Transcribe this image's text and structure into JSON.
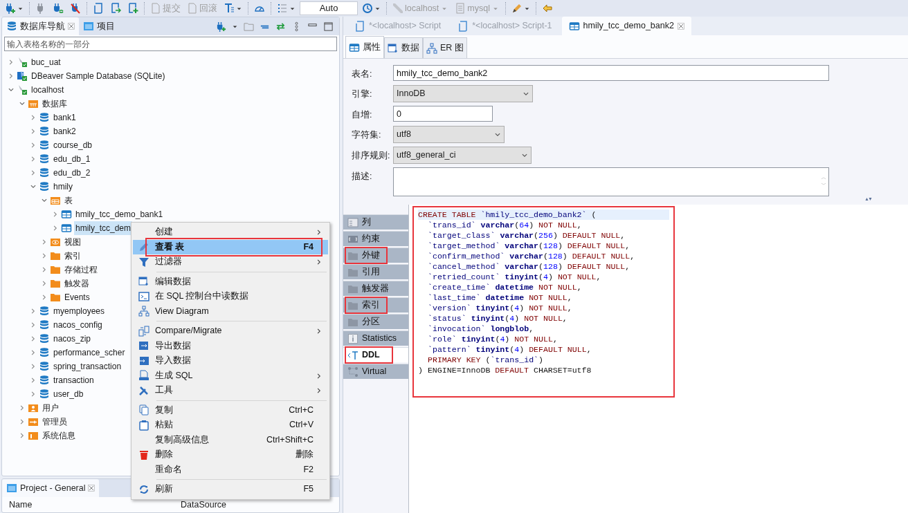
{
  "toolbar": [
    {
      "kind": "icon",
      "dropdown": true
    },
    {
      "kind": "separator"
    },
    {
      "kind": "icon",
      "dropdown": false
    },
    {
      "kind": "icon",
      "dropdown": false
    },
    {
      "kind": "icon",
      "dropdown": false
    },
    {
      "kind": "separator"
    },
    {
      "kind": "icon",
      "dropdown": false
    },
    {
      "kind": "icon",
      "dropdown": false
    },
    {
      "kind": "icon",
      "dropdown": false
    },
    {
      "kind": "separator"
    },
    {
      "kind": "button",
      "label": "提交",
      "disabled": true
    },
    {
      "kind": "button",
      "label": "回滚",
      "disabled": true
    },
    {
      "kind": "icon",
      "dropdown": true
    },
    {
      "kind": "separator"
    },
    {
      "kind": "icon",
      "dropdown": false
    },
    {
      "kind": "separator"
    },
    {
      "kind": "icon",
      "dropdown": true
    },
    {
      "kind": "field",
      "value": "Auto"
    },
    {
      "kind": "icon",
      "dropdown": true
    },
    {
      "kind": "separator"
    },
    {
      "kind": "combo",
      "label": "localhost",
      "disabled": true
    },
    {
      "kind": "combo",
      "label": "mysql",
      "disabled": true
    },
    {
      "kind": "separator"
    },
    {
      "kind": "icon",
      "dropdown": true
    },
    {
      "kind": "separator"
    },
    {
      "kind": "icon",
      "dropdown": false
    }
  ],
  "navigator": {
    "tabs": [
      {
        "label": "数据库导航",
        "selected": true,
        "closable": true
      },
      {
        "label": "项目",
        "selected": false,
        "closable": false
      }
    ],
    "search": {
      "placeholder": "输入表格名称的一部分"
    },
    "tree": [
      {
        "label": "buc_uat",
        "kind": "connection",
        "expanded": false,
        "selected": false
      },
      {
        "label": "DBeaver Sample Database (SQLite)",
        "kind": "sqlite",
        "expanded": false,
        "selected": false
      },
      {
        "label": "localhost",
        "kind": "connection",
        "expanded": true,
        "selected": false,
        "children": [
          {
            "label": "数据库",
            "kind": "databases",
            "expanded": true,
            "selected": false,
            "children": [
              {
                "label": "bank1",
                "kind": "db",
                "expanded": false,
                "selected": false
              },
              {
                "label": "bank2",
                "kind": "db",
                "expanded": false,
                "selected": false
              },
              {
                "label": "course_db",
                "kind": "db",
                "expanded": false,
                "selected": false
              },
              {
                "label": "edu_db_1",
                "kind": "db",
                "expanded": false,
                "selected": false
              },
              {
                "label": "edu_db_2",
                "kind": "db",
                "expanded": false,
                "selected": false
              },
              {
                "label": "hmily",
                "kind": "db",
                "expanded": true,
                "selected": false,
                "children": [
                  {
                    "label": "表",
                    "kind": "tables",
                    "expanded": true,
                    "selected": false,
                    "children": [
                      {
                        "label": "hmily_tcc_demo_bank1",
                        "kind": "table",
                        "expanded": false,
                        "selected": false
                      },
                      {
                        "label": "hmily_tcc_dem",
                        "kind": "table",
                        "expanded": false,
                        "selected": true
                      }
                    ]
                  },
                  {
                    "label": "视图",
                    "kind": "views",
                    "expanded": false,
                    "selected": false
                  },
                  {
                    "label": "索引",
                    "kind": "folder",
                    "expanded": false,
                    "selected": false
                  },
                  {
                    "label": "存储过程",
                    "kind": "folder",
                    "expanded": false,
                    "selected": false
                  },
                  {
                    "label": "触发器",
                    "kind": "folder",
                    "expanded": false,
                    "selected": false
                  },
                  {
                    "label": "Events",
                    "kind": "folder",
                    "expanded": false,
                    "selected": false
                  }
                ]
              },
              {
                "label": "myemployees",
                "kind": "db",
                "expanded": false,
                "selected": false
              },
              {
                "label": "nacos_config",
                "kind": "db",
                "expanded": false,
                "selected": false
              },
              {
                "label": "nacos_zip",
                "kind": "db",
                "expanded": false,
                "selected": false
              },
              {
                "label": "performance_scher",
                "kind": "db",
                "expanded": false,
                "selected": false
              },
              {
                "label": "spring_transaction",
                "kind": "db",
                "expanded": false,
                "selected": false
              },
              {
                "label": "transaction",
                "kind": "db",
                "expanded": false,
                "selected": false
              },
              {
                "label": "user_db",
                "kind": "db",
                "expanded": false,
                "selected": false
              }
            ]
          },
          {
            "label": "用户",
            "kind": "users",
            "expanded": false,
            "selected": false
          },
          {
            "label": "管理员",
            "kind": "admin",
            "expanded": false,
            "selected": false
          },
          {
            "label": "系统信息",
            "kind": "info",
            "expanded": false,
            "selected": false
          }
        ]
      }
    ]
  },
  "project_panel": {
    "tab": "Project - General",
    "columns": [
      "Name",
      "DataSource"
    ]
  },
  "context_menu": [
    {
      "kind": "item",
      "label": "创建",
      "submenu": true,
      "selected": false,
      "annotated": false
    },
    {
      "kind": "item",
      "label": "查看 表",
      "shortcut": "F4",
      "submenu": false,
      "selected": true,
      "annotated": true
    },
    {
      "kind": "item",
      "label": "过滤器",
      "submenu": true,
      "selected": false,
      "annotated": false
    },
    {
      "kind": "separator"
    },
    {
      "kind": "item",
      "label": "编辑数据",
      "submenu": false,
      "selected": false,
      "annotated": false
    },
    {
      "kind": "item",
      "label": "在 SQL 控制台中读数据",
      "submenu": false,
      "selected": false,
      "annotated": false
    },
    {
      "kind": "item",
      "label": "View Diagram",
      "submenu": false,
      "selected": false,
      "annotated": false
    },
    {
      "kind": "separator"
    },
    {
      "kind": "item",
      "label": "Compare/Migrate",
      "submenu": true,
      "selected": false,
      "annotated": false
    },
    {
      "kind": "item",
      "label": "导出数据",
      "submenu": false,
      "selected": false,
      "annotated": false
    },
    {
      "kind": "item",
      "label": "导入数据",
      "submenu": false,
      "selected": false,
      "annotated": false
    },
    {
      "kind": "item",
      "label": "生成 SQL",
      "submenu": true,
      "selected": false,
      "annotated": false
    },
    {
      "kind": "item",
      "label": "工具",
      "submenu": true,
      "selected": false,
      "annotated": false
    },
    {
      "kind": "separator"
    },
    {
      "kind": "item",
      "label": "复制",
      "shortcut": "Ctrl+C",
      "submenu": false,
      "selected": false,
      "annotated": false
    },
    {
      "kind": "item",
      "label": "粘贴",
      "shortcut": "Ctrl+V",
      "submenu": false,
      "selected": false,
      "annotated": false
    },
    {
      "kind": "item",
      "label": "复制高级信息",
      "shortcut": "Ctrl+Shift+C",
      "submenu": false,
      "selected": false,
      "annotated": false
    },
    {
      "kind": "item",
      "label": "删除",
      "shortcut": "删除",
      "submenu": false,
      "selected": false,
      "annotated": false
    },
    {
      "kind": "item",
      "label": "重命名",
      "shortcut": "F2",
      "submenu": false,
      "selected": false,
      "annotated": false
    },
    {
      "kind": "separator"
    },
    {
      "kind": "item",
      "label": "刷新",
      "shortcut": "F5",
      "submenu": false,
      "selected": false,
      "annotated": false
    }
  ],
  "editor": {
    "tabs": [
      {
        "label": "*<localhost> Script",
        "selected": false,
        "closable": false
      },
      {
        "label": "*<localhost> Script-1",
        "selected": false,
        "closable": false
      },
      {
        "label": "hmily_tcc_demo_bank2",
        "selected": true,
        "closable": true
      }
    ],
    "subtabs": [
      {
        "label": "属性",
        "selected": true
      },
      {
        "label": "数据",
        "selected": false
      },
      {
        "label": "ER 图",
        "selected": false
      }
    ],
    "fields": [
      {
        "label": "表名:",
        "kind": "text",
        "value": "hmily_tcc_demo_bank2"
      },
      {
        "label": "引擎:",
        "kind": "select",
        "value": "InnoDB"
      },
      {
        "label": "自增:",
        "kind": "text",
        "value": "0"
      },
      {
        "label": "字符集:",
        "kind": "select",
        "value": "utf8"
      },
      {
        "label": "排序规则:",
        "kind": "select",
        "value": "utf8_general_ci"
      },
      {
        "label": "描述:",
        "kind": "textarea"
      }
    ],
    "side_tabs": [
      {
        "label": "列",
        "selected": false,
        "annotated": false
      },
      {
        "label": "约束",
        "selected": false,
        "annotated": false
      },
      {
        "label": "外键",
        "selected": false,
        "annotated": true
      },
      {
        "label": "引用",
        "selected": false,
        "annotated": false
      },
      {
        "label": "触发器",
        "selected": false,
        "annotated": false
      },
      {
        "label": "索引",
        "selected": false,
        "annotated": true
      },
      {
        "label": "分区",
        "selected": false,
        "annotated": false
      },
      {
        "label": "Statistics",
        "selected": false,
        "annotated": false
      },
      {
        "label": "DDL",
        "selected": true,
        "annotated": true
      },
      {
        "label": "Virtual",
        "selected": false,
        "annotated": false
      }
    ],
    "ddl": {
      "annotated": true,
      "lines": [
        {
          "indent": false,
          "tokens": [
            {
              "kind": "kw",
              "text": "CREATE TABLE "
            },
            {
              "kind": "ident",
              "text": "`hmily_tcc_demo_bank2` "
            },
            {
              "kind": "plain",
              "text": "("
            }
          ]
        },
        {
          "indent": true,
          "tokens": [
            {
              "kind": "ident",
              "text": "`trans_id` "
            },
            {
              "kind": "type",
              "text": "varchar"
            },
            {
              "kind": "plain",
              "text": "("
            },
            {
              "kind": "num",
              "text": "64"
            },
            {
              "kind": "plain",
              "text": ") "
            },
            {
              "kind": "kw",
              "text": "NOT NULL"
            },
            {
              "kind": "plain",
              "text": ","
            }
          ]
        },
        {
          "indent": true,
          "tokens": [
            {
              "kind": "ident",
              "text": "`target_class` "
            },
            {
              "kind": "type",
              "text": "varchar"
            },
            {
              "kind": "plain",
              "text": "("
            },
            {
              "kind": "num",
              "text": "256"
            },
            {
              "kind": "plain",
              "text": ") "
            },
            {
              "kind": "kw",
              "text": "DEFAULT NULL"
            },
            {
              "kind": "plain",
              "text": ","
            }
          ]
        },
        {
          "indent": true,
          "tokens": [
            {
              "kind": "ident",
              "text": "`target_method` "
            },
            {
              "kind": "type",
              "text": "varchar"
            },
            {
              "kind": "plain",
              "text": "("
            },
            {
              "kind": "num",
              "text": "128"
            },
            {
              "kind": "plain",
              "text": ") "
            },
            {
              "kind": "kw",
              "text": "DEFAULT NULL"
            },
            {
              "kind": "plain",
              "text": ","
            }
          ]
        },
        {
          "indent": true,
          "tokens": [
            {
              "kind": "ident",
              "text": "`confirm_method` "
            },
            {
              "kind": "type",
              "text": "varchar"
            },
            {
              "kind": "plain",
              "text": "("
            },
            {
              "kind": "num",
              "text": "128"
            },
            {
              "kind": "plain",
              "text": ") "
            },
            {
              "kind": "kw",
              "text": "DEFAULT NULL"
            },
            {
              "kind": "plain",
              "text": ","
            }
          ]
        },
        {
          "indent": true,
          "tokens": [
            {
              "kind": "ident",
              "text": "`cancel_method` "
            },
            {
              "kind": "type",
              "text": "varchar"
            },
            {
              "kind": "plain",
              "text": "("
            },
            {
              "kind": "num",
              "text": "128"
            },
            {
              "kind": "plain",
              "text": ") "
            },
            {
              "kind": "kw",
              "text": "DEFAULT NULL"
            },
            {
              "kind": "plain",
              "text": ","
            }
          ]
        },
        {
          "indent": true,
          "tokens": [
            {
              "kind": "ident",
              "text": "`retried_count` "
            },
            {
              "kind": "type",
              "text": "tinyint"
            },
            {
              "kind": "plain",
              "text": "("
            },
            {
              "kind": "num",
              "text": "4"
            },
            {
              "kind": "plain",
              "text": ") "
            },
            {
              "kind": "kw",
              "text": "NOT NULL"
            },
            {
              "kind": "plain",
              "text": ","
            }
          ]
        },
        {
          "indent": true,
          "tokens": [
            {
              "kind": "ident",
              "text": "`create_time` "
            },
            {
              "kind": "type",
              "text": "datetime "
            },
            {
              "kind": "kw",
              "text": "NOT NULL"
            },
            {
              "kind": "plain",
              "text": ","
            }
          ]
        },
        {
          "indent": true,
          "tokens": [
            {
              "kind": "ident",
              "text": "`last_time` "
            },
            {
              "kind": "type",
              "text": "datetime "
            },
            {
              "kind": "kw",
              "text": "NOT NULL"
            },
            {
              "kind": "plain",
              "text": ","
            }
          ]
        },
        {
          "indent": true,
          "tokens": [
            {
              "kind": "ident",
              "text": "`version` "
            },
            {
              "kind": "type",
              "text": "tinyint"
            },
            {
              "kind": "plain",
              "text": "("
            },
            {
              "kind": "num",
              "text": "4"
            },
            {
              "kind": "plain",
              "text": ") "
            },
            {
              "kind": "kw",
              "text": "NOT NULL"
            },
            {
              "kind": "plain",
              "text": ","
            }
          ]
        },
        {
          "indent": true,
          "tokens": [
            {
              "kind": "ident",
              "text": "`status` "
            },
            {
              "kind": "type",
              "text": "tinyint"
            },
            {
              "kind": "plain",
              "text": "("
            },
            {
              "kind": "num",
              "text": "4"
            },
            {
              "kind": "plain",
              "text": ") "
            },
            {
              "kind": "kw",
              "text": "NOT NULL"
            },
            {
              "kind": "plain",
              "text": ","
            }
          ]
        },
        {
          "indent": true,
          "tokens": [
            {
              "kind": "ident",
              "text": "`invocation` "
            },
            {
              "kind": "type",
              "text": "longblob"
            },
            {
              "kind": "plain",
              "text": ","
            }
          ]
        },
        {
          "indent": true,
          "tokens": [
            {
              "kind": "ident",
              "text": "`role` "
            },
            {
              "kind": "type",
              "text": "tinyint"
            },
            {
              "kind": "plain",
              "text": "("
            },
            {
              "kind": "num",
              "text": "4"
            },
            {
              "kind": "plain",
              "text": ") "
            },
            {
              "kind": "kw",
              "text": "NOT NULL"
            },
            {
              "kind": "plain",
              "text": ","
            }
          ]
        },
        {
          "indent": true,
          "tokens": [
            {
              "kind": "ident",
              "text": "`pattern` "
            },
            {
              "kind": "type",
              "text": "tinyint"
            },
            {
              "kind": "plain",
              "text": "("
            },
            {
              "kind": "num",
              "text": "4"
            },
            {
              "kind": "plain",
              "text": ") "
            },
            {
              "kind": "kw",
              "text": "DEFAULT NULL"
            },
            {
              "kind": "plain",
              "text": ","
            }
          ]
        },
        {
          "indent": true,
          "tokens": [
            {
              "kind": "kw",
              "text": "PRIMARY KEY "
            },
            {
              "kind": "plain",
              "text": "("
            },
            {
              "kind": "ident",
              "text": "`trans_id`"
            },
            {
              "kind": "plain",
              "text": ")"
            }
          ]
        },
        {
          "indent": false,
          "tokens": [
            {
              "kind": "plain",
              "text": ") ENGINE=InnoDB "
            },
            {
              "kind": "kw",
              "text": "DEFAULT "
            },
            {
              "kind": "plain",
              "text": "CHARSET=utf8"
            }
          ]
        }
      ]
    }
  }
}
